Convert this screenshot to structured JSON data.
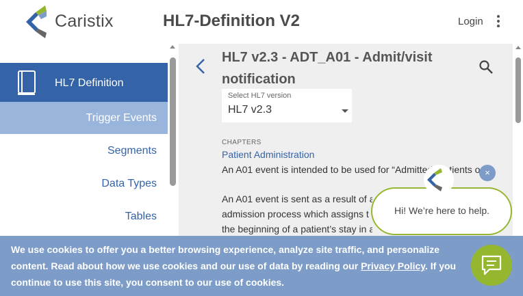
{
  "header": {
    "brand": "Caristix",
    "app_title": "HL7-Definition V2",
    "login": "Login"
  },
  "sidebar": {
    "main_item": "HL7 Definition",
    "items": [
      {
        "label": "Trigger Events",
        "active": true
      },
      {
        "label": "Segments",
        "active": false
      },
      {
        "label": "Data Types",
        "active": false
      },
      {
        "label": "Tables",
        "active": false
      }
    ]
  },
  "content": {
    "title": "HL7 v2.3 - ADT_A01 - Admit/visit notification",
    "version_select": {
      "label": "Select HL7 version",
      "value": "HL7 v2.3"
    },
    "chapters_label": "CHAPTERS",
    "chapter_link": "Patient Administration",
    "paragraphs": [
      "An A01 event is intended to be used for “Admitted” patients o",
      "An A01 event is sent as a result of a",
      "admission process which assigns t",
      "the beginning of a patient’s stay in a"
    ]
  },
  "chat": {
    "message": "Hi! We’re here to help.",
    "close": "×"
  },
  "cookie": {
    "text_before": "We use cookies to offer you a better browsing experience, analyze site traffic, and personalize content. Read about how we use cookies and our use of data by reading our ",
    "link": "Privacy Policy",
    "text_after": ". If you continue to use this site, you consent to our use of cookies."
  },
  "colors": {
    "primary": "#3463a8",
    "nav_active": "#9ab5dc",
    "cookie_bg": "#7d9cc7",
    "accent_green": "#95b730",
    "panel_bg": "#efefef"
  },
  "icons": [
    "caristix-logo",
    "kebab-menu-icon",
    "book-icon",
    "chevron-left-icon",
    "search-icon",
    "caret-down-icon",
    "close-icon",
    "chat-icon"
  ]
}
